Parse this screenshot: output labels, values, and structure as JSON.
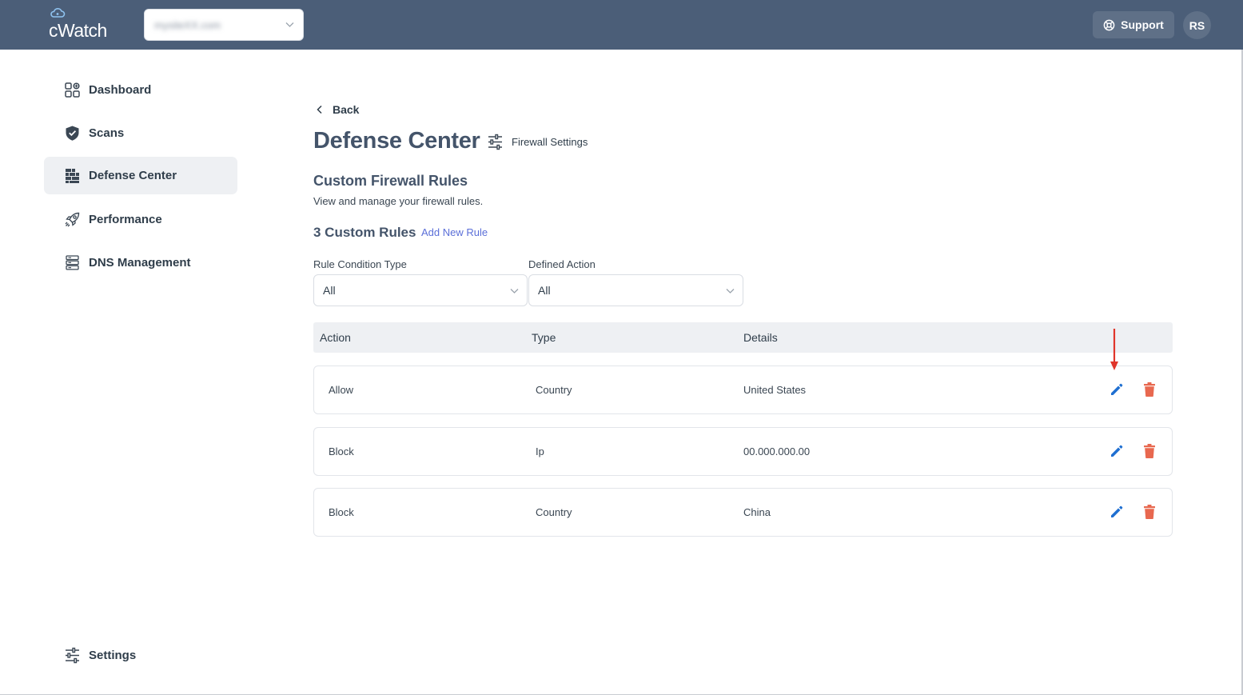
{
  "header": {
    "logo_text": "cWatch",
    "site_selector_value": "mysiteXX.com",
    "support_label": "Support",
    "avatar_initials": "RS"
  },
  "sidebar": {
    "items": [
      {
        "label": "Dashboard",
        "icon": "dashboard-grid-icon"
      },
      {
        "label": "Scans",
        "icon": "shield-check-icon"
      },
      {
        "label": "Defense Center",
        "icon": "firewall-brick-icon",
        "active": true
      },
      {
        "label": "Performance",
        "icon": "rocket-icon"
      },
      {
        "label": "DNS Management",
        "icon": "server-icon"
      }
    ],
    "settings_label": "Settings"
  },
  "main": {
    "back_label": "Back",
    "page_title": "Defense Center",
    "firewall_settings_label": "Firewall Settings",
    "section_title": "Custom Firewall Rules",
    "section_subtitle": "View and manage your firewall rules.",
    "rules_count_label": "3 Custom Rules",
    "add_rule_label": "Add New Rule",
    "filters": {
      "condition_type": {
        "label": "Rule Condition Type",
        "value": "All"
      },
      "defined_action": {
        "label": "Defined Action",
        "value": "All"
      }
    },
    "table": {
      "columns": [
        "Action",
        "Type",
        "Details"
      ],
      "rows": [
        {
          "action": "Allow",
          "type": "Country",
          "details": "United States"
        },
        {
          "action": "Block",
          "type": "Ip",
          "details": "00.000.000.00"
        },
        {
          "action": "Block",
          "type": "Country",
          "details": "China"
        }
      ]
    }
  },
  "colors": {
    "header_bg": "#4b5e78",
    "edit_icon": "#1f6fd1",
    "delete_icon": "#e8684f",
    "link": "#5b6fd8",
    "annotation_arrow": "#e0352b"
  }
}
